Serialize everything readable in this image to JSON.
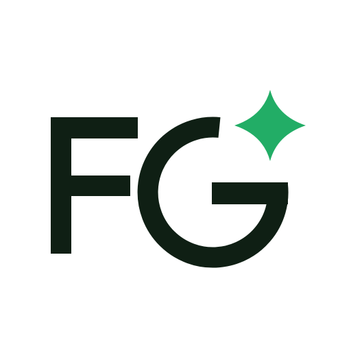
{
  "logo": {
    "text": "FG",
    "icon": "sparkle-icon",
    "colors": {
      "background": "#ffffff",
      "letters": "#0f1f14",
      "sparkle": "#22ad66"
    }
  }
}
